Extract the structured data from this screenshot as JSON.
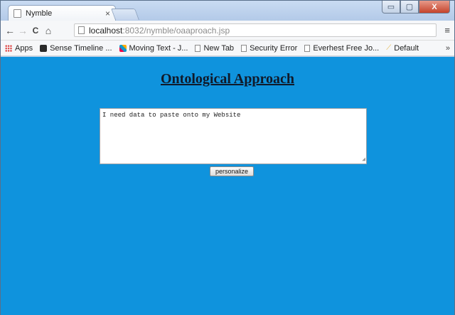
{
  "browser": {
    "tab": {
      "title": "Nymble",
      "close": "×"
    },
    "window_buttons": {
      "minimize": "▭",
      "maximize": "▢",
      "close": "X"
    },
    "nav": {
      "back": "←",
      "forward": "→",
      "reload": "C",
      "home": "⌂"
    },
    "address": {
      "host": "localhost",
      "path": ":8032/nymble/oaaproach.jsp"
    },
    "menu": "≡",
    "bookmarks": [
      {
        "label": "Apps"
      },
      {
        "label": "Sense Timeline ..."
      },
      {
        "label": "Moving Text - J..."
      },
      {
        "label": "New Tab"
      },
      {
        "label": "Security Error"
      },
      {
        "label": "Everhest Free Jo..."
      },
      {
        "label": "Default"
      }
    ],
    "bookmarks_more": "»"
  },
  "page": {
    "title": "Ontological Approach",
    "textarea_value": "I need data to paste onto my Website",
    "button_label": "personalize",
    "background": "#0f93dd"
  }
}
